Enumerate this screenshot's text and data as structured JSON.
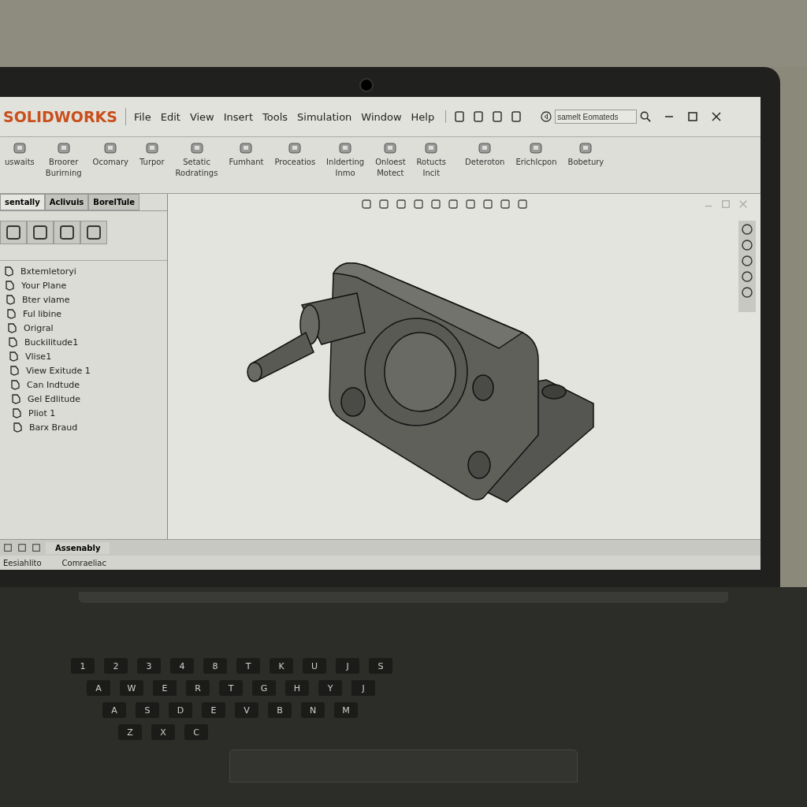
{
  "app": {
    "logo": "SOLIDWORKS"
  },
  "menu": [
    "File",
    "Edit",
    "View",
    "Insert",
    "Tools",
    "Simulation",
    "Window",
    "Help"
  ],
  "search": {
    "placeholder": "samelt Eomateds"
  },
  "ribbon": [
    {
      "lines": [
        "uswaits"
      ]
    },
    {
      "lines": [
        "Broorer",
        "Burirning"
      ]
    },
    {
      "lines": [
        "Ocomary"
      ]
    },
    {
      "lines": [
        "Turpor"
      ]
    },
    {
      "lines": [
        "Setatic",
        "Rodratings"
      ]
    },
    {
      "lines": [
        "Fumhant"
      ]
    },
    {
      "lines": [
        "Proceatios"
      ]
    },
    {
      "lines": [
        "Inlderting",
        "Inmo"
      ]
    },
    {
      "lines": [
        "Onloest",
        "Motect"
      ]
    },
    {
      "lines": [
        "Rotucts",
        "Incit"
      ]
    },
    {
      "lines": [
        "Deteroton"
      ]
    },
    {
      "lines": [
        "Erichlcpon"
      ]
    },
    {
      "lines": [
        "Bobetury"
      ]
    }
  ],
  "panel_tabs": [
    {
      "label": "sentally",
      "selected": true
    },
    {
      "label": "Aclivuis",
      "selected": false
    },
    {
      "label": "BorelTule",
      "selected": false
    }
  ],
  "tree": [
    "Bxtemletoryi",
    "Your Plane",
    "Bter vlame",
    "Ful libine",
    "Origral",
    "Buckilitude1",
    "Vlise1",
    "View Exitude 1",
    "Can Indtude",
    "Gel Edlitude",
    "Pliot 1",
    "Barx Braud"
  ],
  "bottom_tabs": [
    {
      "label": "Assenably",
      "selected": true
    }
  ],
  "status": [
    "Eesiahlito",
    "Comraeliac"
  ],
  "keyboard": [
    [
      "1",
      "2",
      "3",
      "4",
      "8",
      "T",
      "K",
      "U",
      "J",
      "S"
    ],
    [
      "A",
      "W",
      "E",
      "R",
      "T",
      "G",
      "H",
      "Y",
      "J"
    ],
    [
      "A",
      "S",
      "D",
      "E",
      "V",
      "B",
      "N",
      "M"
    ],
    [
      "Z",
      "X",
      "C"
    ]
  ]
}
